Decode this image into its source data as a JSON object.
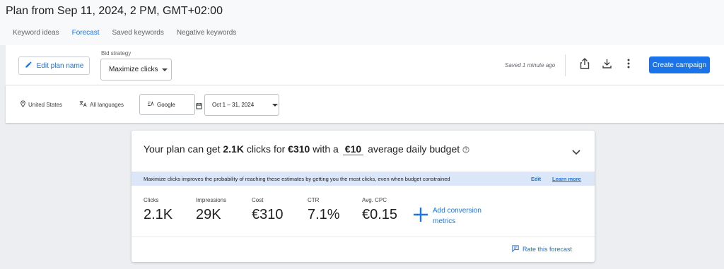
{
  "header": {
    "plan_title": "Plan from Sep 11, 2024, 2 PM, GMT+02:00"
  },
  "tabs": [
    {
      "label": "Keyword ideas",
      "active": false
    },
    {
      "label": "Forecast",
      "active": true
    },
    {
      "label": "Saved keywords",
      "active": false
    },
    {
      "label": "Negative keywords",
      "active": false
    }
  ],
  "toolbar": {
    "edit_plan_label": "Edit plan name",
    "bid_strategy_label": "Bid strategy",
    "bid_strategy_value": "Maximize clicks",
    "saved_status": "Saved 1 minute ago",
    "create_campaign_label": "Create campaign"
  },
  "filters": {
    "location": "United States",
    "language": "All languages",
    "network": "Google",
    "date_range": "Oct 1 – 31, 2024"
  },
  "forecast": {
    "headline_prefix": "Your plan can get",
    "clicks_highlight": "2.1K",
    "headline_mid1": "clicks for",
    "cost_highlight": "€310",
    "headline_mid2": "with a",
    "daily_budget": "€10",
    "headline_suffix": "average daily budget",
    "info_text": "Maximize clicks improves the probability of reaching these estimates by getting you the most clicks, even when budget constrained",
    "info_edit": "Edit",
    "info_learn_more": "Learn more",
    "metrics": [
      {
        "label": "Clicks",
        "value": "2.1K"
      },
      {
        "label": "Impressions",
        "value": "29K"
      },
      {
        "label": "Cost",
        "value": "€310"
      },
      {
        "label": "CTR",
        "value": "7.1%"
      },
      {
        "label": "Avg. CPC",
        "value": "€0.15"
      }
    ],
    "add_conversion_label": "Add conversion metrics",
    "rate_label": "Rate this forecast"
  },
  "colors": {
    "accent": "#1a73e8",
    "info_bar": "#dbe7f8",
    "page_bg": "#eceef1"
  }
}
